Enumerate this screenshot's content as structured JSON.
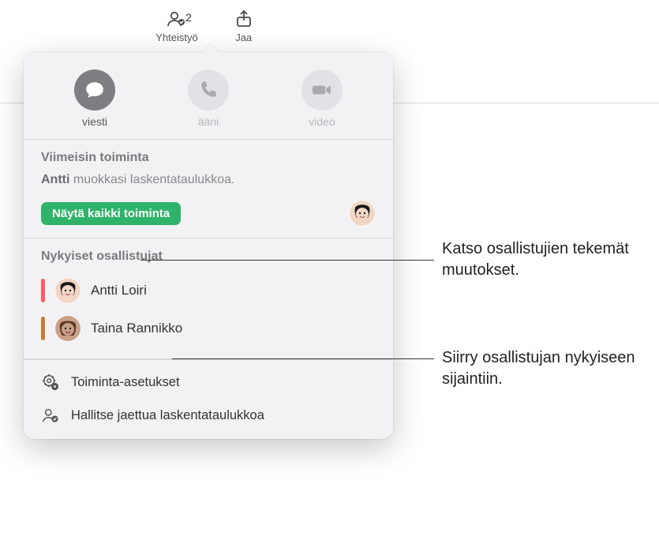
{
  "toolbar": {
    "collaborate": {
      "label": "Yhteistyö",
      "count": "2"
    },
    "share": {
      "label": "Jaa"
    }
  },
  "comm": {
    "message": "viesti",
    "audio": "ääni",
    "video": "video"
  },
  "activity": {
    "title": "Viimeisin toiminta",
    "actor": "Antti",
    "text": "muokkasi laskentataulukkoa.",
    "show_all": "Näytä kaikki toiminta"
  },
  "participants": {
    "title": "Nykyiset osallistujat",
    "list": [
      {
        "name": "Antti Loiri",
        "color": "#ff5a63"
      },
      {
        "name": "Taina Rannikko",
        "color": "#c97a3a"
      }
    ]
  },
  "settings": {
    "activity": "Toiminta-asetukset",
    "manage": "Hallitse jaettua laskentataulukkoa"
  },
  "callouts": {
    "changes": "Katso osallistujien tekemät muutokset.",
    "jump": "Siirry osallistujan nykyiseen sijaintiin."
  }
}
